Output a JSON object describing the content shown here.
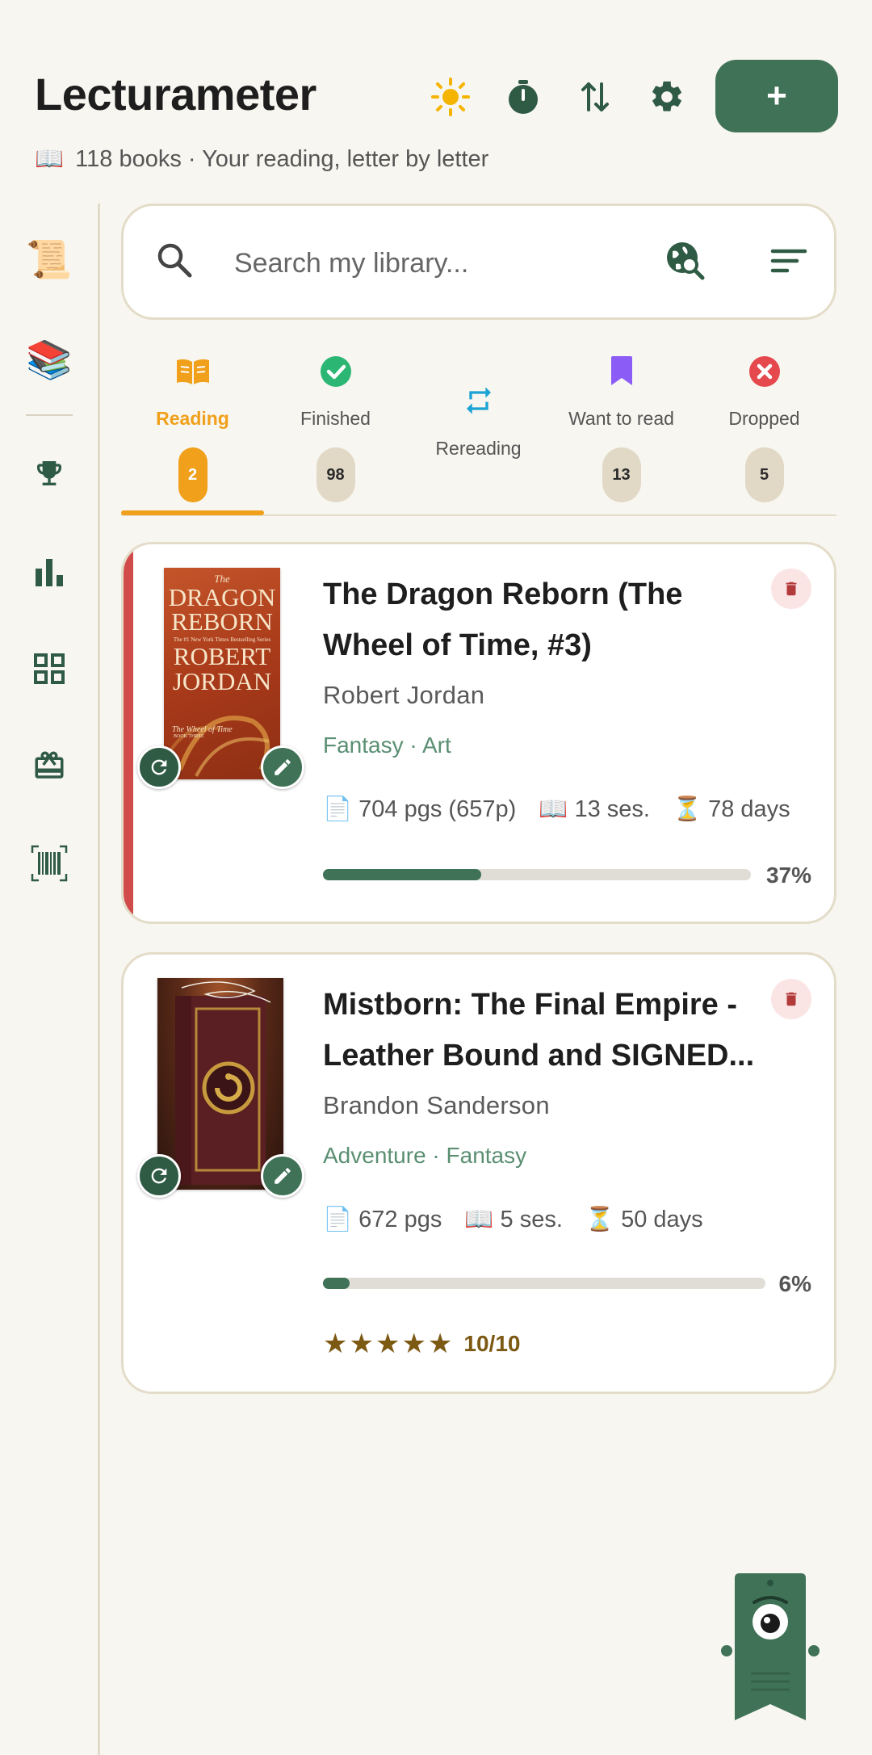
{
  "header": {
    "title": "Lecturameter",
    "subtitle_icon": "📖",
    "subtitle": "118 books · Your reading, letter by letter",
    "actions": [
      "theme-sun-icon",
      "timer-icon",
      "sort-arrows-icon",
      "settings-gear-icon"
    ],
    "add_label": "+"
  },
  "sidebar": {
    "items": [
      {
        "name": "scroll-icon",
        "glyph": "📜"
      },
      {
        "name": "books-icon",
        "glyph": "📚"
      },
      {
        "name": "trophy-icon"
      },
      {
        "name": "chart-icon"
      },
      {
        "name": "grid-icon"
      },
      {
        "name": "gift-icon"
      },
      {
        "name": "barcode-icon"
      }
    ]
  },
  "search": {
    "placeholder": "Search my library..."
  },
  "tabs": [
    {
      "label": "Reading",
      "count": "2",
      "active": true
    },
    {
      "label": "Finished",
      "count": "98"
    },
    {
      "label": "Rereading",
      "count": ""
    },
    {
      "label": "Want to read",
      "count": "13"
    },
    {
      "label": "Dropped",
      "count": "5"
    }
  ],
  "books": [
    {
      "title": "The Dragon Reborn (The Wheel of Time, #3)",
      "title_line1": "The Dragon Reborn (The",
      "title_line2": "Wheel of Time, #3)",
      "author": "Robert Jordan",
      "genres": "Fantasy · Art",
      "pages": "704 pgs (657p)",
      "sessions": "13 ses.",
      "days": "78 days",
      "progress": 37,
      "progress_label": "37%",
      "cover": {
        "line1": "The",
        "line2": "DRAGON",
        "line3": "REBORN",
        "tagline": "The #1 New York Times Bestselling Series",
        "line4": "ROBERT",
        "line5": "JORDAN",
        "series": "The Wheel of Time",
        "book": "BOOK THREE"
      }
    },
    {
      "title": "Mistborn: The Final Empire - Leather Bound and SIGNED...",
      "title_line1": "Mistborn: The Final Empire -",
      "title_line2": "Leather Bound and SIGNED...",
      "author": "Brandon Sanderson",
      "genres": "Adventure · Fantasy",
      "pages": "672 pgs",
      "sessions": "5 ses.",
      "days": "50 days",
      "progress": 6,
      "progress_label": "6%",
      "stars": "★★★★★",
      "rating": "10/10"
    }
  ],
  "colors": {
    "accent_green": "#3f7256",
    "active_tab": "#f0a01a",
    "reading_accent": "#d24b4b",
    "background": "#f8f6f0"
  }
}
